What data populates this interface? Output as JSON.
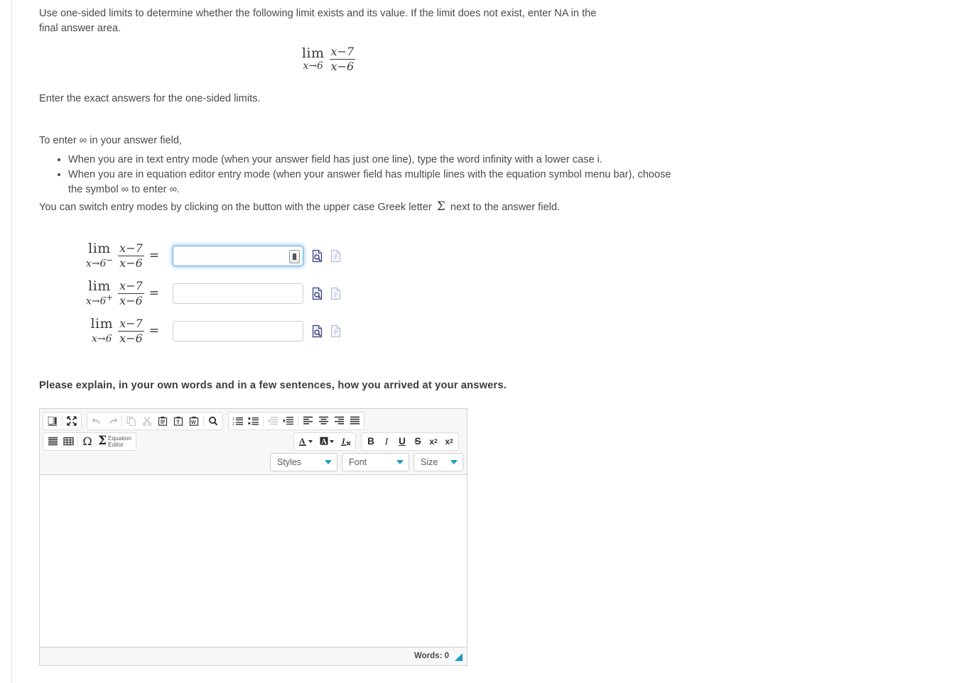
{
  "question": {
    "intro": "Use one-sided limits to determine whether the following limit exists and its value. If the limit does not exist, enter NA in the final answer area.",
    "display_limit": {
      "lim": "lim",
      "sub": "x→6",
      "numerator": "x−7",
      "denominator": "x−6"
    },
    "exact_answers_note": "Enter the exact answers for the one-sided limits.",
    "to_enter_infinity": "To enter ∞ in your answer field,",
    "bullets": [
      "When you are in text entry mode (when your answer field has just one line), type the word infinity with a lower case i.",
      "When you are in equation editor entry mode (when your answer field has multiple lines with the equation symbol menu bar), choose the symbol ∞ to enter ∞."
    ],
    "switch_modes_before": "You can switch entry modes by clicking on the button with the upper case Greek letter",
    "switch_modes_symbol": "Σ",
    "switch_modes_after": "next to the answer field."
  },
  "answer_rows": [
    {
      "lim": "lim",
      "sub_base": "x→6",
      "sub_sign": "−",
      "numerator": "x−7",
      "denominator": "x−6",
      "equals": "=",
      "value": "",
      "focused": true
    },
    {
      "lim": "lim",
      "sub_base": "x→6",
      "sub_sign": "+",
      "numerator": "x−7",
      "denominator": "x−6",
      "equals": "=",
      "value": "",
      "focused": false
    },
    {
      "lim": "lim",
      "sub_base": "x→6",
      "sub_sign": "",
      "numerator": "x−7",
      "denominator": "x−6",
      "equals": "=",
      "value": "",
      "focused": false
    }
  ],
  "explain_prompt": "Please explain, in your own words and in a few sentences, how you arrived at your answers.",
  "editor": {
    "toolbar": {
      "group1": [
        {
          "name": "source-icon",
          "title": "Source"
        },
        {
          "name": "maximize-icon",
          "title": "Maximize"
        }
      ],
      "group2": [
        {
          "name": "undo-icon",
          "title": "Undo"
        },
        {
          "name": "redo-icon",
          "title": "Redo"
        },
        {
          "name": "copy-icon",
          "title": "Copy"
        },
        {
          "name": "cut-icon",
          "title": "Cut"
        },
        {
          "name": "paste-icon",
          "title": "Paste"
        },
        {
          "name": "paste-text-icon",
          "title": "Paste as plain text"
        },
        {
          "name": "paste-word-icon",
          "title": "Paste from Word"
        },
        {
          "name": "find-icon",
          "title": "Find"
        }
      ],
      "group3": [
        {
          "name": "numbered-list-icon",
          "title": "Insert/Remove Numbered List"
        },
        {
          "name": "bulleted-list-icon",
          "title": "Insert/Remove Bulleted List"
        },
        {
          "name": "outdent-icon",
          "title": "Decrease Indent"
        },
        {
          "name": "indent-icon",
          "title": "Increase Indent"
        },
        {
          "name": "align-left-icon",
          "title": "Align Left"
        },
        {
          "name": "align-center-icon",
          "title": "Center"
        },
        {
          "name": "align-right-icon",
          "title": "Align Right"
        },
        {
          "name": "justify-icon",
          "title": "Justify"
        }
      ],
      "group4": [
        {
          "name": "horizontal-rule-icon",
          "title": "Insert Horizontal Line"
        },
        {
          "name": "table-icon",
          "title": "Table"
        },
        {
          "name": "special-char-icon",
          "title": "Insert Special Character",
          "glyph": "Ω"
        },
        {
          "name": "equation-editor-icon",
          "title": "Equation Editor",
          "glyph": "Σ",
          "label_line1": "Equation",
          "label_line2": "Editor"
        }
      ],
      "group5": [
        {
          "name": "text-color-icon",
          "title": "Text Color",
          "glyph": "A"
        },
        {
          "name": "background-color-icon",
          "title": "Background Color",
          "glyph": "A"
        },
        {
          "name": "remove-format-icon",
          "title": "Remove Format",
          "glyph": "I"
        }
      ],
      "group6": [
        {
          "name": "bold-icon",
          "title": "Bold",
          "glyph": "B"
        },
        {
          "name": "italic-icon",
          "title": "Italic",
          "glyph": "I"
        },
        {
          "name": "underline-icon",
          "title": "Underline",
          "glyph": "U"
        },
        {
          "name": "strikethrough-icon",
          "title": "Strike Through",
          "glyph": "S"
        },
        {
          "name": "subscript-icon",
          "title": "Subscript",
          "glyph": "x",
          "script": "2"
        },
        {
          "name": "superscript-icon",
          "title": "Superscript",
          "glyph": "x",
          "script": "2"
        }
      ]
    },
    "selects": [
      {
        "name": "styles-select",
        "label": "Styles"
      },
      {
        "name": "font-select",
        "label": "Font"
      },
      {
        "name": "size-select",
        "label": "Size"
      }
    ],
    "body_value": "",
    "status": {
      "words_label": "Words: 0"
    }
  },
  "colors": {
    "accent_teal": "#1b9cc4",
    "focus_blue": "#66afe9",
    "body_text": "#4a4a4a",
    "border_gray": "#d1d1d1",
    "toolbar_bg": "#f7f7f7"
  }
}
